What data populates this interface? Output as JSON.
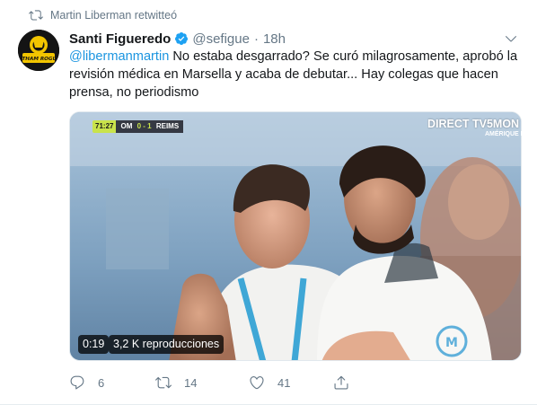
{
  "retweet_notice": {
    "text": "Martin Liberman retwitteó",
    "icon": "retweet-icon"
  },
  "author": {
    "name": "Santi Figueredo",
    "handle": "@sefigue",
    "time": "18h",
    "verified": true,
    "avatar_logo_text": "GOTHAM ROGUES"
  },
  "tweet": {
    "mention": "@libermanmartin",
    "text": " No estaba desgarrado? Se curó milagrosamente, aprobó la revisión médica en Marsella y acaba de debutar... Hay colegas que hacen prensa, no periodismo"
  },
  "media": {
    "scorebug": {
      "clock": "71:27",
      "home": "OM",
      "score": "0 - 1",
      "away": "REIMS"
    },
    "channel": "DIRECT TV5MON",
    "channel_sub": "AMÉRIQUE L",
    "duration": "0:19",
    "views": "3,2 K reproducciones"
  },
  "actions": {
    "replies": "6",
    "retweets": "14",
    "likes": "41"
  },
  "colors": {
    "accent": "#1b95e0",
    "muted": "#657786",
    "verified": "#1da1f2"
  }
}
